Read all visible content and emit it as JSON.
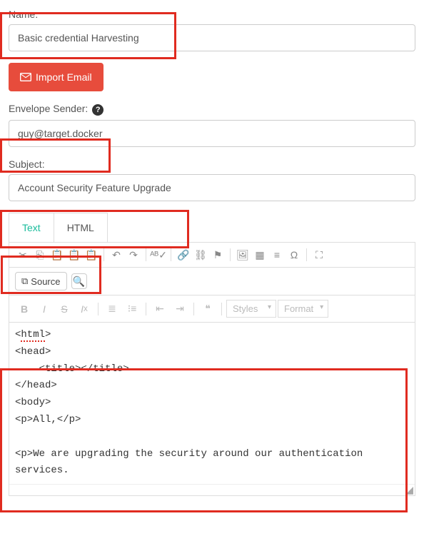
{
  "name": {
    "label": "Name:",
    "value": "Basic credential Harvesting"
  },
  "importBtn": "Import Email",
  "envelope": {
    "label": "Envelope Sender:",
    "value": "guy@target.docker"
  },
  "subject": {
    "label": "Subject:",
    "value": "Account Security Feature Upgrade"
  },
  "tabs": {
    "text": "Text",
    "html": "HTML"
  },
  "toolbar": {
    "source": "Source",
    "styles": "Styles",
    "format": "Format"
  },
  "source_lines": [
    "<html>",
    "<head>",
    "\t<title></title>",
    "</head>",
    "<body>",
    "<p>All,</p>",
    "",
    "<p>We are upgrading the security around our authentication services."
  ]
}
